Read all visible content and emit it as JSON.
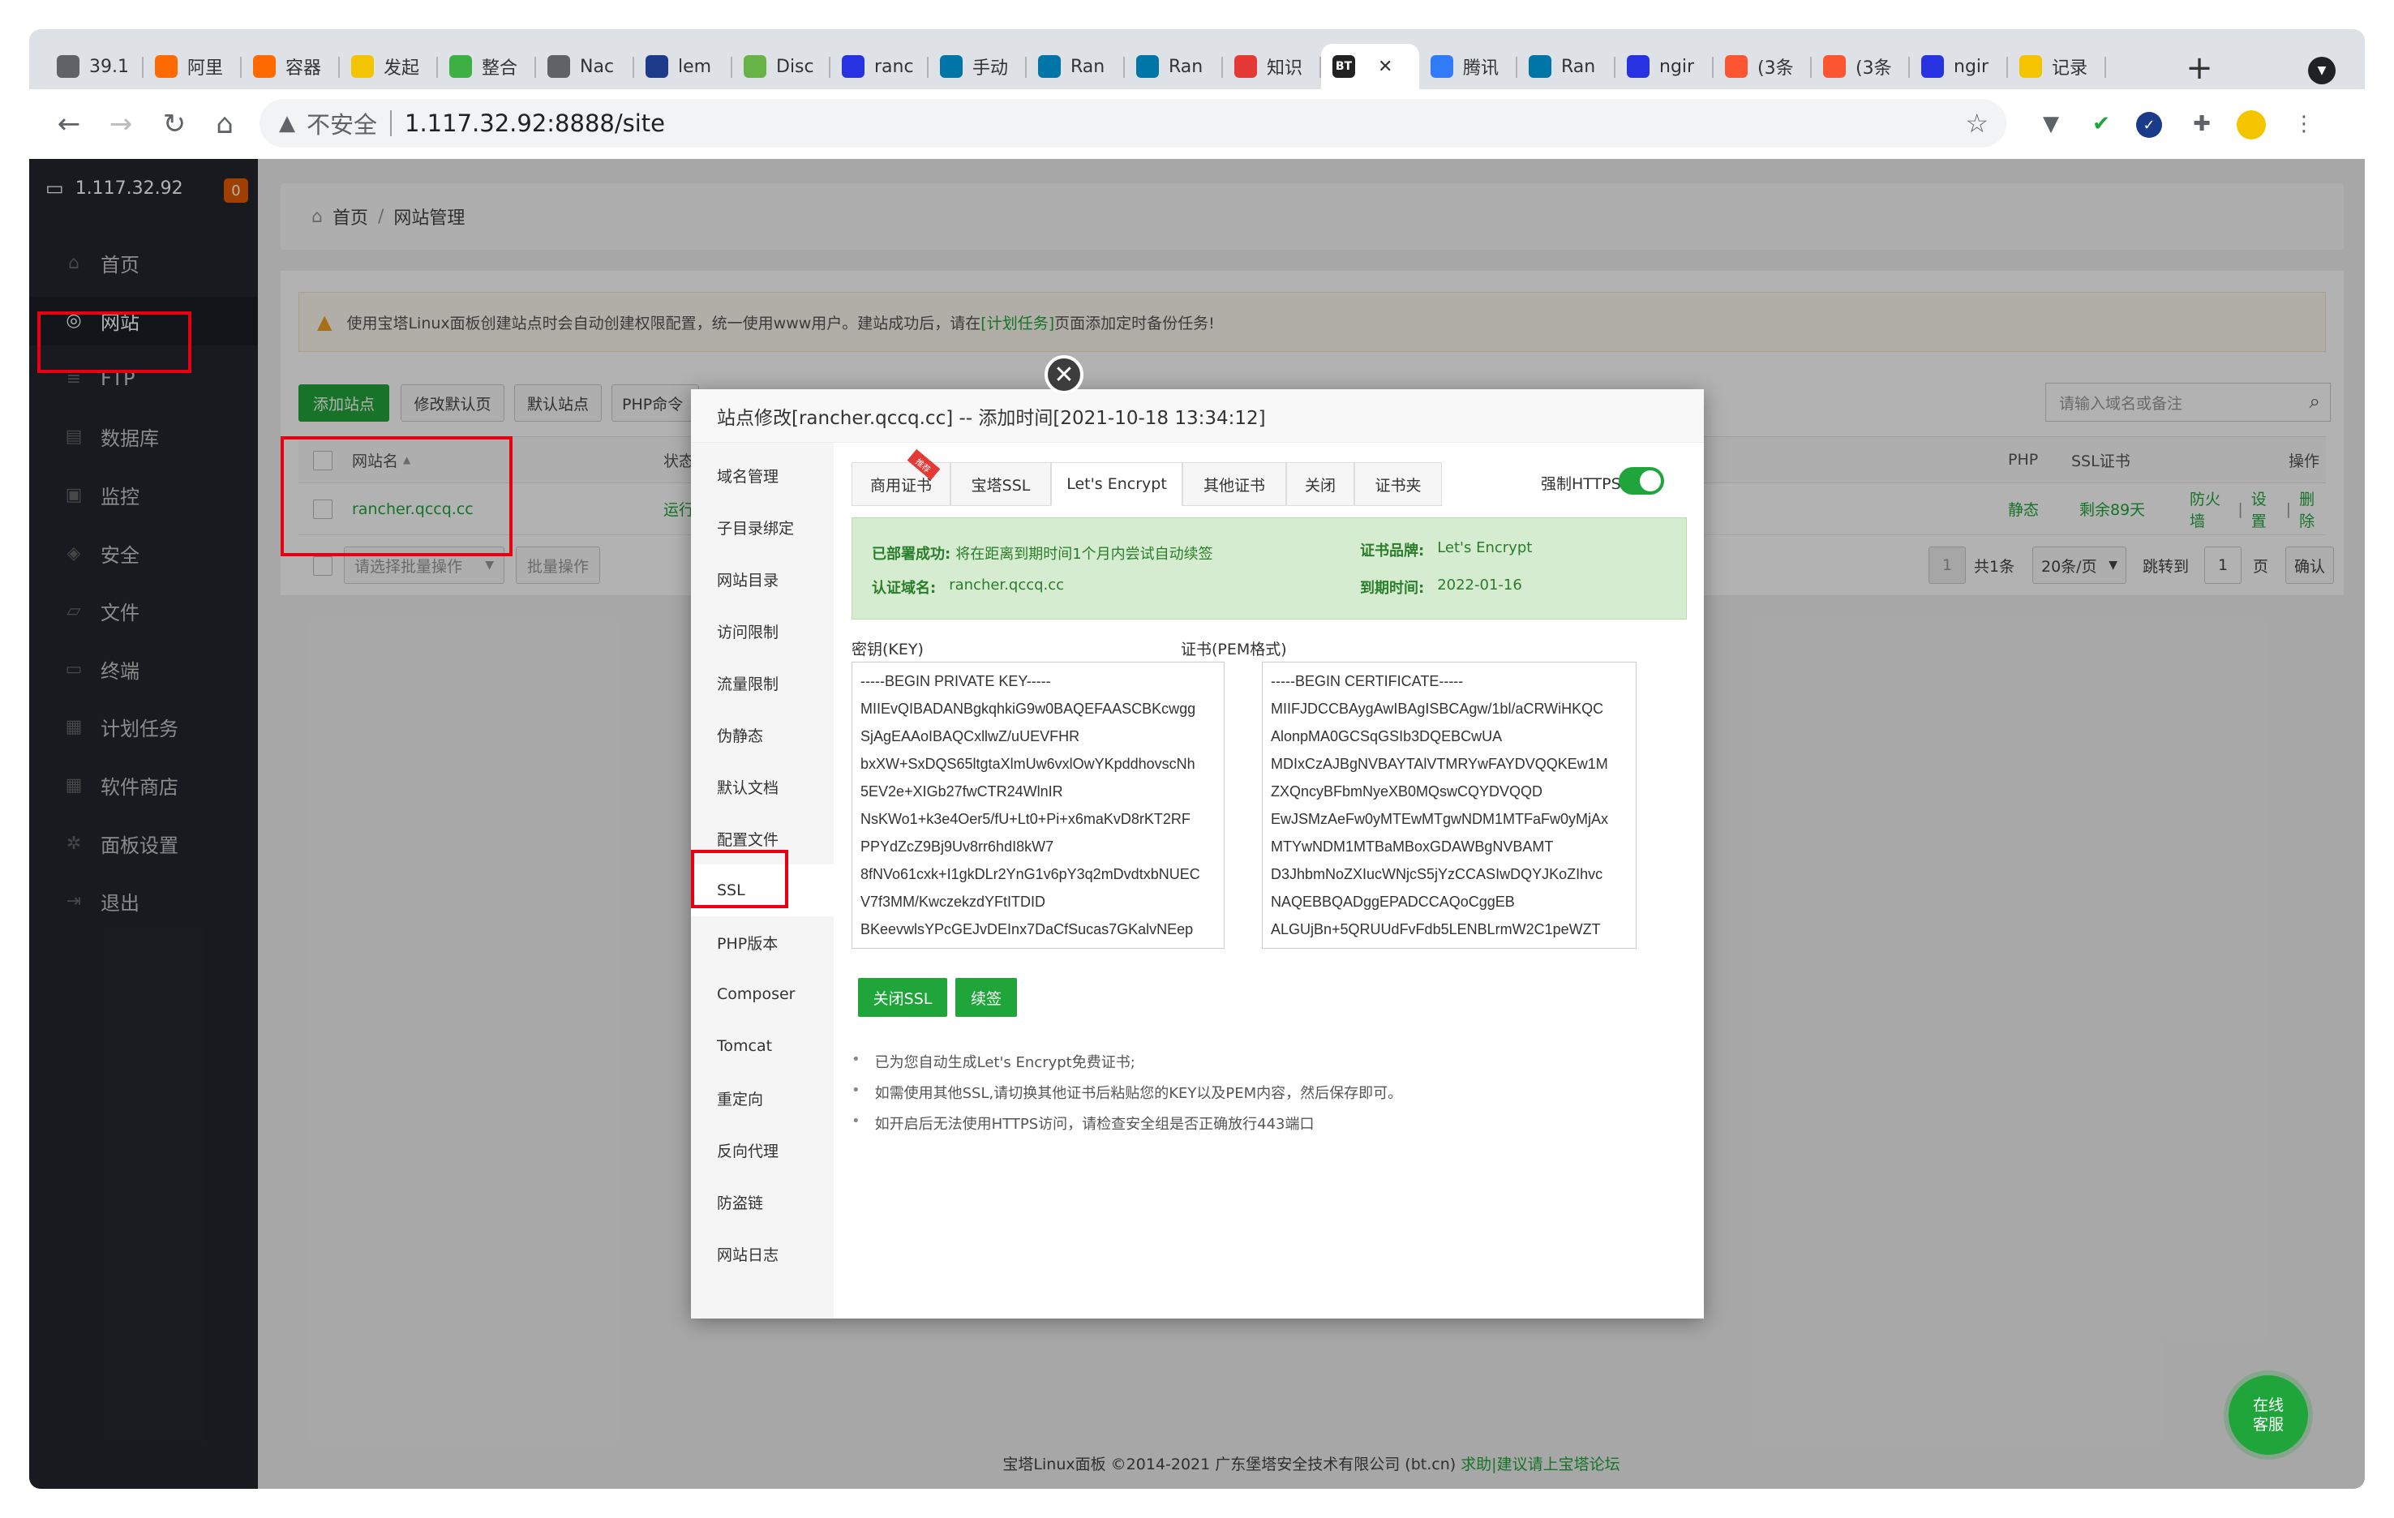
{
  "browser": {
    "tabs": [
      {
        "label": "39.1",
        "icon": "globe-icon",
        "color": "#5f6368"
      },
      {
        "label": "阿里",
        "icon": "aliyun-icon",
        "color": "#ff6a00"
      },
      {
        "label": "容器",
        "icon": "aliyun-icon",
        "color": "#ff6a00"
      },
      {
        "label": "发起",
        "icon": "smile-icon",
        "color": "#f5c400"
      },
      {
        "label": "整合",
        "icon": "leaf-icon",
        "color": "#3cb043"
      },
      {
        "label": "Nac",
        "icon": "globe-icon",
        "color": "#5f6368"
      },
      {
        "label": "lem",
        "icon": "check-icon",
        "color": "#1e3a8a"
      },
      {
        "label": "Disc",
        "icon": "discourse-icon",
        "color": "#67b346"
      },
      {
        "label": "ranc",
        "icon": "baidu-icon",
        "color": "#2932e1"
      },
      {
        "label": "手动",
        "icon": "rancher-icon",
        "color": "#0075a8"
      },
      {
        "label": "Ran",
        "icon": "rancher-icon",
        "color": "#0075a8"
      },
      {
        "label": "Ran",
        "icon": "rancher-icon",
        "color": "#0075a8"
      },
      {
        "label": "知识",
        "icon": "g-icon",
        "color": "#e53935"
      },
      {
        "label": "BT",
        "icon": "bt-icon",
        "color": "#222222",
        "active": true
      },
      {
        "label": "腾讯",
        "icon": "cloud-icon",
        "color": "#2f7cf6"
      },
      {
        "label": "Ran",
        "icon": "rancher-icon",
        "color": "#0075a8"
      },
      {
        "label": "ngir",
        "icon": "baidu-icon",
        "color": "#2932e1"
      },
      {
        "label": "(3条",
        "icon": "csdn-icon",
        "color": "#fc5531"
      },
      {
        "label": "(3条",
        "icon": "csdn-icon",
        "color": "#fc5531"
      },
      {
        "label": "ngir",
        "icon": "baidu-icon",
        "color": "#2932e1"
      },
      {
        "label": "记录",
        "icon": "note-icon",
        "color": "#f5c400"
      }
    ],
    "active_tab_close": "✕",
    "new_tab": "+",
    "omnibox": {
      "security_label": "不安全",
      "url": "1.117.32.92:8888/site"
    }
  },
  "sidebar": {
    "host": "1.117.32.92",
    "badge": "0",
    "items": [
      {
        "label": "首页",
        "icon": "home-icon"
      },
      {
        "label": "网站",
        "icon": "globe-icon",
        "active": true
      },
      {
        "label": "FTP",
        "icon": "ftp-icon"
      },
      {
        "label": "数据库",
        "icon": "database-icon"
      },
      {
        "label": "监控",
        "icon": "monitor-icon"
      },
      {
        "label": "安全",
        "icon": "shield-icon"
      },
      {
        "label": "文件",
        "icon": "folder-icon"
      },
      {
        "label": "终端",
        "icon": "terminal-icon"
      },
      {
        "label": "计划任务",
        "icon": "calendar-icon"
      },
      {
        "label": "软件商店",
        "icon": "grid-icon"
      },
      {
        "label": "面板设置",
        "icon": "gear-icon"
      },
      {
        "label": "退出",
        "icon": "logout-icon"
      }
    ]
  },
  "breadcrumb": {
    "home": "首页",
    "sep": "/",
    "current": "网站管理"
  },
  "notice": {
    "text_before": "使用宝塔Linux面板创建站点时会自动创建权限配置，统一使用www用户。建站成功后，请在",
    "link": "[计划任务]",
    "text_after": "页面添加定时备份任务!"
  },
  "actions": {
    "add_site": "添加站点",
    "edit_default_page": "修改默认页",
    "default_site": "默认站点",
    "php_cmd": "PHP命令"
  },
  "search_placeholder": "请输入域名或备注",
  "table": {
    "headers": {
      "name": "网站名",
      "sort": "▲",
      "status": "状态",
      "php": "PHP",
      "ssl": "SSL证书",
      "ops": "操作"
    },
    "rows": [
      {
        "name": "rancher.qccq.cc",
        "status": "运行中",
        "php": "静态",
        "ssl": "剩余89天",
        "op_firewall": "防火墙",
        "op_settings": "设置",
        "op_delete": "删除"
      }
    ],
    "op_sep": "|"
  },
  "batch": {
    "select_placeholder": "请选择批量操作",
    "apply": "批量操作"
  },
  "pager": {
    "page": "1",
    "total": "共1条",
    "per_page": "20条/页",
    "goto": "跳转到",
    "goto_value": "1",
    "page_unit": "页",
    "confirm": "确认"
  },
  "modal": {
    "title": "站点修改[rancher.qccq.cc] -- 添加时间[2021-10-18 13:34:12]",
    "close": "✕",
    "nav": [
      "域名管理",
      "子目录绑定",
      "网站目录",
      "访问限制",
      "流量限制",
      "伪静态",
      "默认文档",
      "配置文件",
      "SSL",
      "PHP版本",
      "Composer",
      "Tomcat",
      "重定向",
      "反向代理",
      "防盗链",
      "网站日志"
    ],
    "ssl_tabs": [
      "商用证书",
      "宝塔SSL",
      "Let's Encrypt",
      "其他证书",
      "关闭",
      "证书夹"
    ],
    "ribbon": "推荐",
    "force_https": "强制HTTPS",
    "status": {
      "deployed_label": "已部署成功:",
      "deployed_text": "将在距离到期时间1个月内尝试自动续签",
      "domain_label": "认证域名:",
      "domain": "rancher.qccq.cc",
      "brand_label": "证书品牌:",
      "brand": "Let's Encrypt",
      "expire_label": "到期时间:",
      "expire": "2022-01-16"
    },
    "key_label": "密钥(KEY)",
    "cert_label": "证书(PEM格式)",
    "key_lines": [
      "-----BEGIN PRIVATE KEY-----",
      "MIIEvQIBADANBgkqhkiG9w0BAQEFAASCBKcwgg",
      "SjAgEAAoIBAQCxllwZ/uUEVFHR",
      "bxXW+SxDQS65ltgtaXlmUw6vxlOwYKpddhovscNh",
      "5EV2e+XIGb27fwCTR24WlnIR",
      "NsKWo1+k3e4Oer5/fU+Lt0+Pi+x6maKvD8rKT2RF",
      "PPYdZcZ9Bj9Uv8rr6hdI8kW7",
      "8fNVo61cxk+I1gkDLr2YnG1v6pY3q2mDvdtxbNUEC",
      "V7f3MM/KwczekzdYFtITDID",
      "BKeevwlsYPcGEJvDEInx7DaCfSucas7GKalvNEep"
    ],
    "cert_lines": [
      "-----BEGIN CERTIFICATE-----",
      "MIIFJDCCBAygAwIBAgISBCAgw/1bl/aCRWiHKQC",
      "AlonpMA0GCSqGSIb3DQEBCwUA",
      "MDIxCzAJBgNVBAYTAlVTMRYwFAYDVQQKEw1M",
      "ZXQncyBFbmNyeXB0MQswCQYDVQQD",
      "EwJSMzAeFw0yMTEwMTgwNDM1MTFaFw0yMjAx",
      "MTYwNDM1MTBaMBoxGDAWBgNVBAMT",
      "D3JhbmNoZXIucWNjcS5jYzCCASIwDQYJKoZIhvc",
      "NAQEBBQADggEPADCCAQoCggEB",
      "ALGUjBn+5QRUUdFvFdb5LENBLrmW2C1peWZT"
    ],
    "btn_close_ssl": "关闭SSL",
    "btn_renew": "续签",
    "tips": [
      "已为您自动生成Let's Encrypt免费证书;",
      "如需使用其他SSL,请切换其他证书后粘贴您的KEY以及PEM内容，然后保存即可。",
      "如开启后无法使用HTTPS访问，请检查安全组是否正确放行443端口"
    ]
  },
  "footer": {
    "copyright": "宝塔Linux面板 ©2014-2021 广东堡塔安全技术有限公司 (bt.cn)",
    "link": "求助|建议请上宝塔论坛"
  },
  "chat": {
    "line1": "在线",
    "line2": "客服"
  }
}
